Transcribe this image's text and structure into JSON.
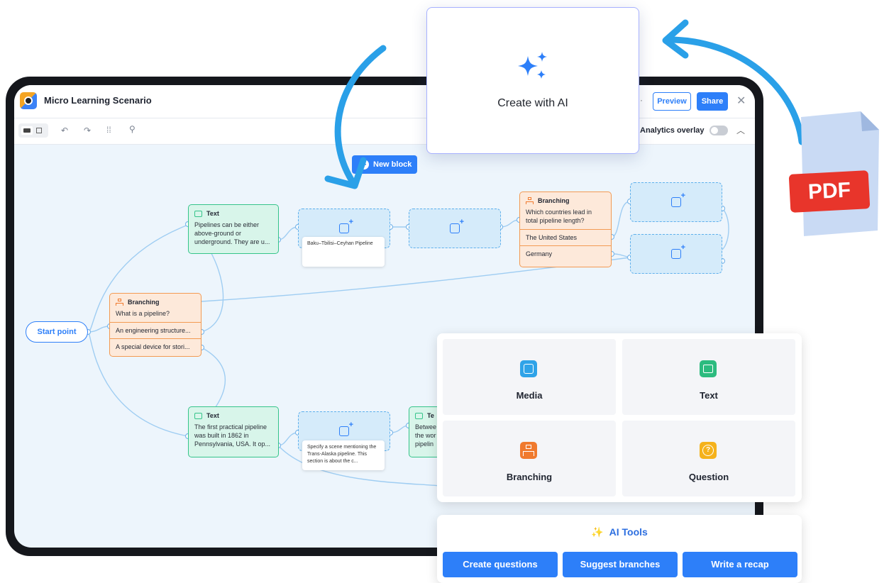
{
  "app": {
    "title": "Micro Learning Scenario",
    "preview_label": "Preview",
    "share_label": "Share",
    "new_block_label": "New block",
    "analytics_overlay_label": "Analytics overlay"
  },
  "canvas": {
    "start_label": "Start point",
    "branching1": {
      "type": "Branching",
      "question": "What is a pipeline?",
      "options": [
        "An engineering structure...",
        "A special device for stori..."
      ]
    },
    "text1": {
      "type": "Text",
      "body": "Pipelines can be either above-ground or underground. They are u..."
    },
    "media1_caption": "Baku–Tbilisi–Ceyhan Pipeline",
    "branching2": {
      "type": "Branching",
      "question": "Which countries lead in total pipeline length?",
      "options": [
        "The United States",
        "Germany"
      ]
    },
    "text2": {
      "type": "Text",
      "body": "The first practical pipeline was built in 1862 in Pennsylvania, USA. It op..."
    },
    "media3_caption": "Specify a scene mentioning the Trans-Alaska pipeline. This section is about the c...",
    "text3": {
      "type": "Te",
      "body": "Betwee the wor pipelin"
    }
  },
  "ai_card": {
    "title": "Create with AI"
  },
  "pdf_label": "PDF",
  "palette": {
    "tiles": [
      {
        "label": "Media",
        "icon": "media-icon",
        "color": "#2fa3e8"
      },
      {
        "label": "Text",
        "icon": "text-icon",
        "color": "#2cbb7f"
      },
      {
        "label": "Branching",
        "icon": "branching-icon",
        "color": "#f07a2e"
      },
      {
        "label": "Question",
        "icon": "question-icon",
        "color": "#f5b21c"
      }
    ]
  },
  "ai_tools": {
    "title": "AI Tools",
    "buttons": [
      "Create questions",
      "Suggest branches",
      "Write a recap"
    ]
  },
  "colors": {
    "accent": "#2d7ff9",
    "text_node": "#35c48a",
    "branch_node": "#f39a52",
    "media_node": "#5fb0ec",
    "arrow": "#2aa0e8"
  }
}
